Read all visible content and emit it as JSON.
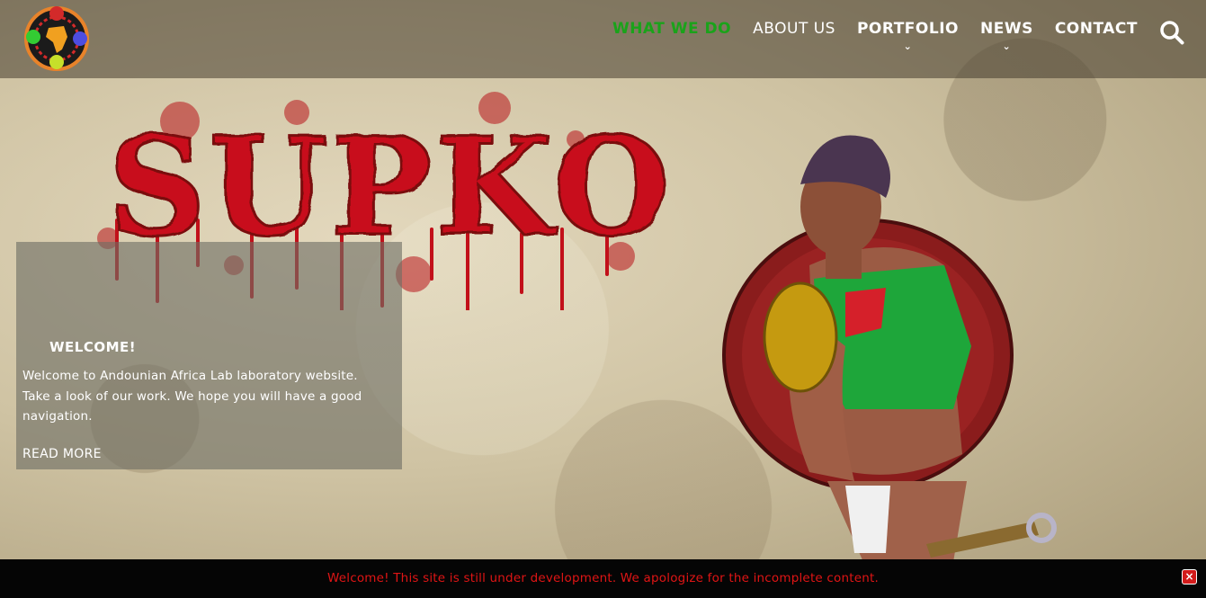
{
  "nav": {
    "items": [
      {
        "label": "WHAT WE DO",
        "active": true,
        "dropdown": false
      },
      {
        "label": "ABOUT US",
        "active": false,
        "dropdown": false
      },
      {
        "label": "PORTFOLIO",
        "active": false,
        "dropdown": true
      },
      {
        "label": "NEWS",
        "active": false,
        "dropdown": true
      },
      {
        "label": "CONTACT",
        "active": false,
        "dropdown": false
      }
    ],
    "chevron": "⌄",
    "search_icon": "search-icon",
    "active_color": "#1aa31a"
  },
  "hero": {
    "title_art_text": "SUPKO"
  },
  "welcome": {
    "title": "WELCOME!",
    "text": "Welcome to Andounian Africa Lab laboratory website. Take a look of our work. We hope you will have a good navigation.",
    "read_more": "READ MORE"
  },
  "notice": {
    "text": "Welcome! This site is still under development. We apologize for the incomplete content.",
    "close_icon": "close-icon",
    "close_glyph": "×",
    "text_color": "#e01515"
  }
}
